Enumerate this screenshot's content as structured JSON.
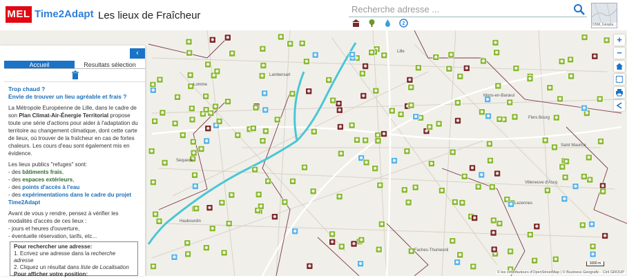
{
  "header": {
    "logo_text": "MEL",
    "brand": "Time2Adapt",
    "title": "Les lieux de Fraîcheur",
    "search_placeholder": "Recherche adresse ...",
    "basemap_label": "OSM_Géopla..."
  },
  "filters": [
    {
      "icon": "building-icon",
      "color": "#7b2a2a"
    },
    {
      "icon": "tree-icon",
      "color": "#6a9a2a"
    },
    {
      "icon": "water-drop-icon",
      "color": "#3aa0d8"
    },
    {
      "icon": "time2adapt-icon",
      "color": "#2f7fd8"
    }
  ],
  "panel": {
    "collapse_label": "‹",
    "tabs": [
      "Accueil",
      "Resultats sélection"
    ],
    "intro_q1": "Trop chaud ?",
    "intro_q2": "Envie de trouver un lieu agréable et frais ?",
    "para1_a": "La Métropole Européenne de Lille, dans le cadre de son ",
    "para1_b": "Plan Climat-Air-Énergie Territorial",
    "para1_c": " propose toute une série d'actions pour aider à l'adaptation du territoire au changement climatique, dont cette carte de lieux, où trouver de la fraîcheur en cas de fortes chaleurs. Les cours d'eau sont également mis en évidence.",
    "refuges_intro": "Les lieux publics \"refuges\" sont:",
    "dash_des": "- des ",
    "refuge1": "bâtiments frais",
    "refuge2": "espaces extérieurs",
    "refuge3": "points d'accès à l'eau",
    "refuge4": "expérimentations dans le cadre du projet Time2Adapt",
    "comma": ",",
    "visit_intro": "Avant de vous y rendre, pensez à vérifier les modalités d'accès de ces lieux :",
    "visit1": "- jours et heures d'ouverture,",
    "visit2": "- éventuelle réservation, tarifs, etc...",
    "box_title": "Pour rechercher une adresse:",
    "box_step1_a": "1. Ecrivez une adresse dans la ",
    "box_step1_b": "recherche adresse",
    "box_step2_a": "2. Cliquez un résultat dans ",
    "box_step2_b": "liste de Localisation",
    "box_title2": "Pour afficher votre position:"
  },
  "map": {
    "places": [
      "Lomme",
      "Lambersart",
      "Lille",
      "Mons-en-Barœul",
      "Flers Bourg",
      "Sequedin",
      "Saint Maurice",
      "Villeneuve d'Ascq",
      "Haubourdin",
      "Lezennes",
      "Faches-Thumesnil"
    ],
    "attribution": "© les contributeurs d'OpenStreetMap | © Business Geografic - Ciril GROUP",
    "scale_label": "1000 m",
    "colors": {
      "green": "#8ab833",
      "brown": "#7b2a2a",
      "blue": "#5ab4e6",
      "river": "#49c6d6",
      "boundary": "#7a3a4a"
    }
  },
  "controls": [
    "+",
    "−",
    "⌂",
    "⬚",
    "⎙",
    "<"
  ]
}
